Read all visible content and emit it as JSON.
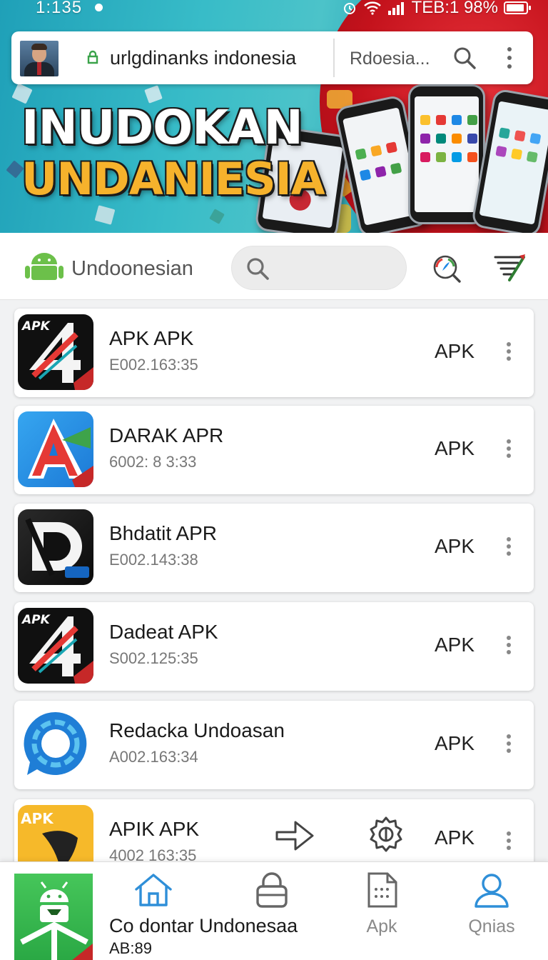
{
  "status_bar": {
    "time": "1:135",
    "right_text": "TEB:1 98%"
  },
  "url_bar": {
    "url": "urlgdinanks indonesia",
    "lang": "Rdoesia..."
  },
  "hero": {
    "title_line1": "INUDOKAN",
    "title_line2": "UNDANIESIA"
  },
  "toolbar": {
    "title": "Undoonesian",
    "search_placeholder": ""
  },
  "apps": [
    {
      "name": "APK APK",
      "meta": "E002.163:35",
      "type": "APK",
      "icon": "apk-4-icon"
    },
    {
      "name": "DARAK APR",
      "meta": "6002: 8 3:33",
      "type": "APK",
      "icon": "red-a-icon"
    },
    {
      "name": "Bhdatit APR",
      "meta": "E002.143:38",
      "type": "APK",
      "icon": "black-d-icon"
    },
    {
      "name": "Dadeat APK",
      "meta": "S002.125:35",
      "type": "APK",
      "icon": "apk-4-icon"
    },
    {
      "name": "Redacka Undoasan",
      "meta": "A002.163:34",
      "type": "APK",
      "icon": "blue-ring-chat-icon"
    },
    {
      "name": "APIK APK",
      "meta": "4002 163:35",
      "type": "APK",
      "icon": "yellow-apk-icon"
    }
  ],
  "bottom_nav": {
    "promo_title": "Co dontar Undonesaa",
    "promo_sub": "AB:89",
    "items": [
      {
        "label": "",
        "icon": "home-icon"
      },
      {
        "label": "",
        "icon": "lock-icon"
      },
      {
        "label": "Apk",
        "icon": "apk-file-icon"
      },
      {
        "label": "Qnias",
        "icon": "person-icon"
      }
    ]
  },
  "colors": {
    "accent_blue": "#2f8fd8",
    "hero_teal": "#38bcc8",
    "hero_red": "#d0202a",
    "title_yellow": "#f6b22c",
    "android_green": "#6cc04a"
  }
}
